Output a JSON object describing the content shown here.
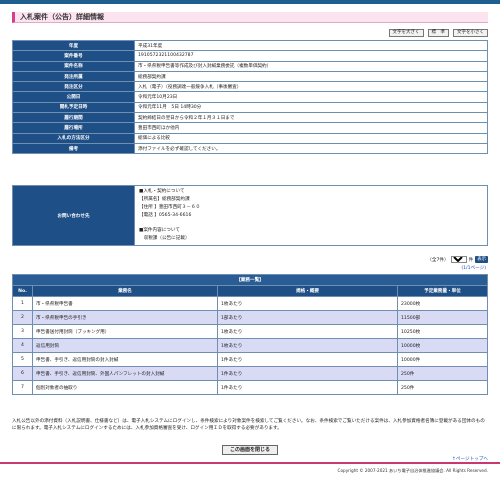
{
  "page": {
    "title": "入札案件（公告）詳細情報"
  },
  "font_size_buttons": [
    "文字を大きく",
    "標　準",
    "文字を小さく"
  ],
  "info_rows": [
    {
      "label": "年度",
      "value": "平成31年度"
    },
    {
      "label": "案件番号",
      "value": "1910572321100432787"
    },
    {
      "label": "案件名称",
      "value": "市・県県税申告書等作成及び封入封緘業務委託（複数単価契約）"
    },
    {
      "label": "発注所属",
      "value": "総務部契約課"
    },
    {
      "label": "発注区分",
      "value": "入札（電子）（役務調達一般競争入札（事後審査）"
    },
    {
      "label": "公開日",
      "value": "令和元年10月23日"
    },
    {
      "label": "開札予定日時",
      "value": "令和元年11月　5日 14時30分"
    },
    {
      "label": "履行期間",
      "value": "契約締結日の翌日から令和２年１月３１日まで"
    },
    {
      "label": "履行場所",
      "value": "豊田市西町ほか他内"
    },
    {
      "label": "入札の方法区分",
      "value": "総価による比較"
    },
    {
      "label": "備考",
      "value": "添付ファイルを必ず確認してください。"
    }
  ],
  "contact": {
    "label": "お問い合わせ先",
    "lines": [
      "■入札・契約について",
      "【所属名】総務部契約課",
      "【住所 】豊田市西町３－６０",
      "【電話 】0565-34-6616",
      "",
      "■案件内容について",
      "　収税課（公告に記載）"
    ]
  },
  "pager": {
    "count_label": "（全7件）",
    "per_page": "30",
    "display_button": "表示",
    "page_indicator": "(1/1ページ)"
  },
  "result": {
    "caption": "【業務一覧】",
    "headers": [
      "No.",
      "業務名",
      "規格・概要",
      "予定業務量・単位"
    ],
    "rows": [
      [
        "1",
        "市・県県税申告書",
        "1枚あたり",
        "23000枚"
      ],
      [
        "2",
        "市・県県税申告の手引き",
        "1部あたり",
        "11500部"
      ],
      [
        "3",
        "申告書送付用封筒（ブッキング用）",
        "1枚あたり",
        "10250枚"
      ],
      [
        "4",
        "返信用封筒",
        "1枚あたり",
        "10000枚"
      ],
      [
        "5",
        "申告書、手引き、返信用封筒の封入封緘",
        "1件あたり",
        "10000件"
      ],
      [
        "6",
        "申告書、手引き、返信用封筒、外国人パンフレットの封入封緘",
        "1件あたり",
        "250件"
      ],
      [
        "7",
        "個別対象者の抽取り",
        "1件あたり",
        "250件"
      ]
    ]
  },
  "note": "入札公告以外の添付資料（入札説明書、仕様書など）は、電子入札システムにログインし、条件検索により対象案件を検索してご覧ください。なお、条件検索でご覧いただける案件は、入札参加資格者名簿に登載がある団体のものに限られます。電子入札システムにログインするためには、入札参加資格審査を受け、ログイン用ＩＤを取得する必要があります。",
  "close_button": "この画面を閉じる",
  "page_top": "↑ページトップへ",
  "footer": "Copyright © 2007-2021 あいち電子自治体推進協議会. All Rights Reserved."
}
